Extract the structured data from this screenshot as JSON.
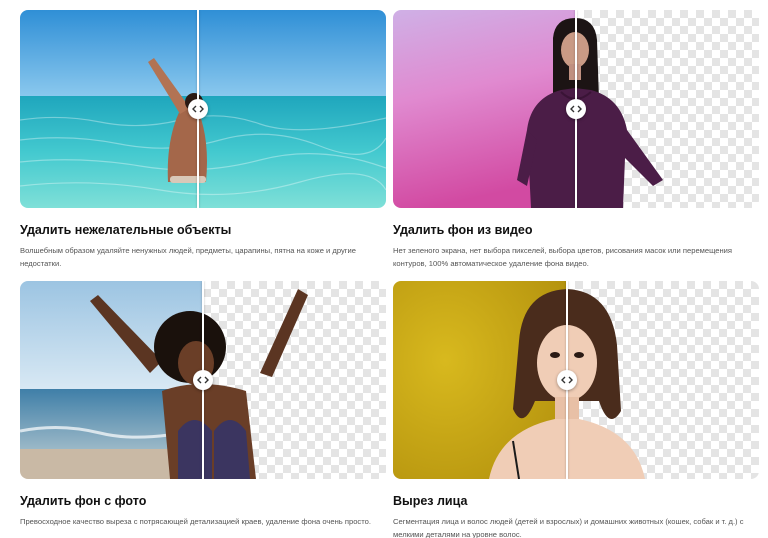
{
  "features": [
    {
      "id": "objects",
      "title": "Удалить нежелательные объекты",
      "description": "Волшебным образом удаляйте ненужных людей, предметы, царапины, пятна на коже и другие недостатки.",
      "scene": "beach-swimmer-in-sea",
      "handle_icon": "code-arrows-icon"
    },
    {
      "id": "video",
      "title": "Удалить фон из видео",
      "description": "Нет зеленого экрана, нет выбора пикселей, выбора цветов, рисования масок или перемещения контуров, 100% автоматическое удаление фона видео.",
      "scene": "woman-purple-top-pink-background",
      "handle_icon": "code-arrows-icon"
    },
    {
      "id": "photo",
      "title": "Удалить фон с фото",
      "description": "Превосходное качество выреза с потрясающей детализацией краев, удаление фона очень просто.",
      "scene": "woman-arms-raised-at-beach",
      "handle_icon": "code-arrows-icon"
    },
    {
      "id": "face",
      "title": "Вырез лица",
      "description": "Сегментация лица и волос людей (детей и взрослых) и домашних животных (кошек, собак и т. д.) с мелкими деталями на уровне волос.",
      "scene": "woman-portrait-yellow-background",
      "handle_icon": "code-arrows-icon"
    }
  ],
  "colors": {
    "sea": "#3fc4cf",
    "sky": "#4aa6e0",
    "pink": "#d85fae",
    "purple_top": "#4a1c45",
    "yellow_bg": "#c9a714",
    "checker_light": "#ffffff",
    "checker_dark": "#e4e4e4"
  }
}
